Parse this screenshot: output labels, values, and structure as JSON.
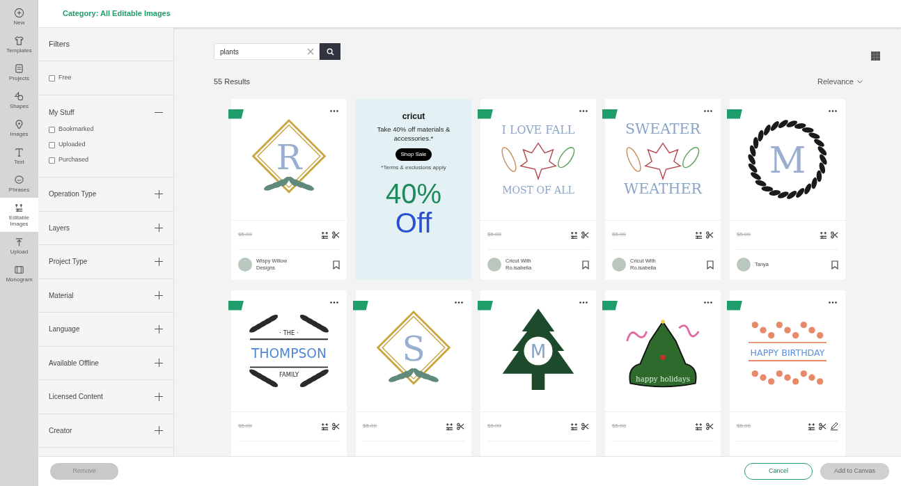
{
  "rail": [
    {
      "label": "New",
      "selected": false
    },
    {
      "label": "Templates",
      "selected": false
    },
    {
      "label": "Projects",
      "selected": false
    },
    {
      "label": "Shapes",
      "selected": false
    },
    {
      "label": "Images",
      "selected": false
    },
    {
      "label": "Text",
      "selected": false
    },
    {
      "label": "Phrases",
      "selected": false
    },
    {
      "label": "Editable Images",
      "selected": true
    },
    {
      "label": "Upload",
      "selected": false
    },
    {
      "label": "Monogram",
      "selected": false
    }
  ],
  "header": {
    "category": "Category: All Editable Images"
  },
  "filters": {
    "title": "Filters",
    "sections": [
      {
        "kind": "free",
        "options": [
          {
            "label": "Free",
            "checked": false
          }
        ]
      },
      {
        "kind": "checks",
        "title": "My Stuff",
        "expanded": true,
        "options": [
          {
            "label": "Bookmarked",
            "checked": false
          },
          {
            "label": "Uploaded",
            "checked": false
          },
          {
            "label": "Purchased",
            "checked": false
          }
        ]
      },
      {
        "kind": "group",
        "title": "Operation Type",
        "expanded": false
      },
      {
        "kind": "group",
        "title": "Layers",
        "expanded": false
      },
      {
        "kind": "group",
        "title": "Project Type",
        "expanded": false
      },
      {
        "kind": "group",
        "title": "Material",
        "expanded": false
      },
      {
        "kind": "group",
        "title": "Language",
        "expanded": false
      },
      {
        "kind": "group",
        "title": "Available Offline",
        "expanded": false
      },
      {
        "kind": "group",
        "title": "Licensed Content",
        "expanded": false
      },
      {
        "kind": "group",
        "title": "Creator",
        "expanded": false
      }
    ]
  },
  "search": {
    "value": "plants"
  },
  "results": {
    "count": "55 Results",
    "sort": "Relevance"
  },
  "cards": [
    {
      "kind": "diamond",
      "art_text": [
        "R"
      ],
      "price": "$5.00",
      "pen": false,
      "creator": "Wispy Willow Designs"
    },
    {
      "kind": "ad",
      "brand": "cricut",
      "headline": "Take 40% off materials & accessories.*",
      "button": "Shop Sale",
      "fine_print": "*Terms & exclusions apply",
      "big_1": "40%",
      "big_2": "Off"
    },
    {
      "kind": "fall",
      "art_text": [
        "I LOVE FALL",
        "MOST OF ALL"
      ],
      "price": "$5.00",
      "pen": false,
      "creator": "Cricut With Ro.isabella"
    },
    {
      "kind": "fall",
      "art_text": [
        "SWEATER",
        "WEATHER"
      ],
      "price": "$5.00",
      "pen": false,
      "creator": "Cricut With Ro.isabella"
    },
    {
      "kind": "wreath",
      "art_text": [
        "M"
      ],
      "price": "$5.00",
      "pen": false,
      "creator": "Tanya"
    },
    {
      "kind": "family",
      "art_text": [
        "· THE ·",
        "THOMPSON",
        "FAMILY"
      ],
      "price": "$5.00",
      "pen": false
    },
    {
      "kind": "diamond",
      "art_text": [
        "S"
      ],
      "price": "$5.00",
      "pen": false
    },
    {
      "kind": "tree",
      "art_text": [
        "M"
      ],
      "price": "$5.00",
      "pen": false
    },
    {
      "kind": "holiday",
      "art_text": [
        "happy holidays"
      ],
      "price": "$5.00",
      "pen": false
    },
    {
      "kind": "birthday",
      "art_text": [
        "HAPPY BIRTHDAY"
      ],
      "price": "$5.00",
      "pen": true
    }
  ],
  "footer": {
    "remove": "Remove",
    "cancel": "Cancel",
    "add": "Add to Canvas"
  }
}
